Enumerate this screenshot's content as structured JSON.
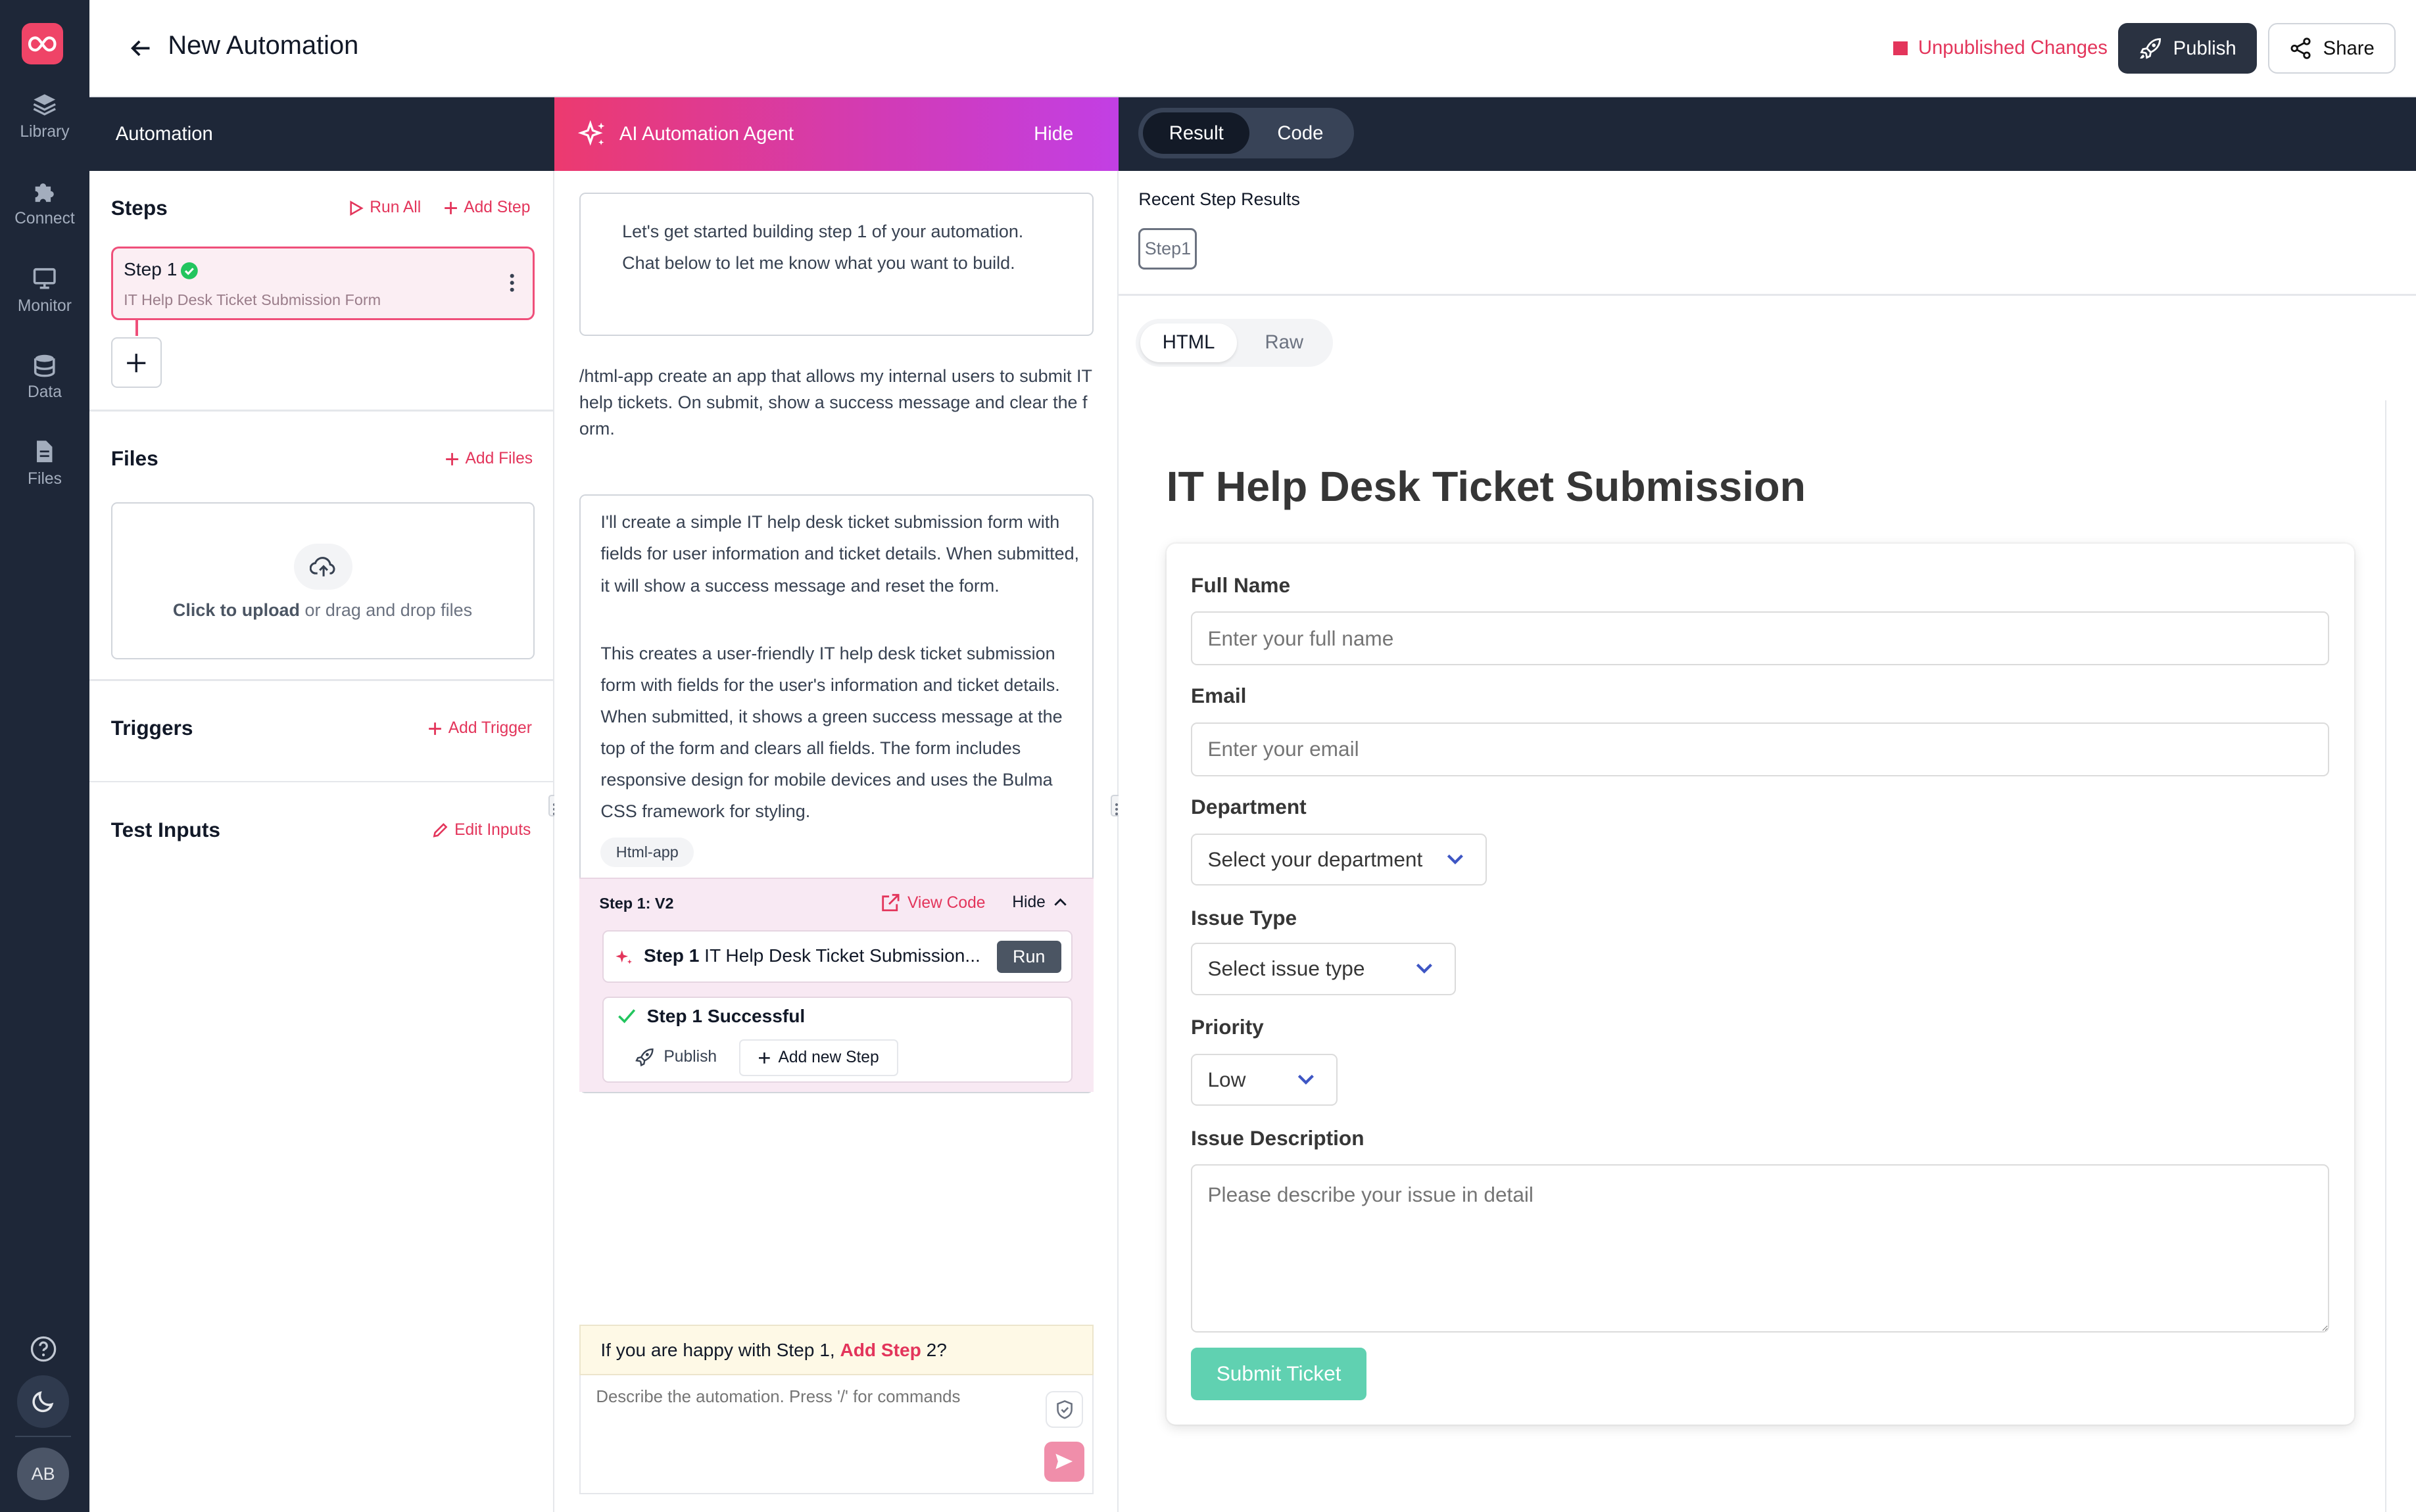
{
  "nav": {
    "items": [
      {
        "label": "Library",
        "icon": "layers-icon"
      },
      {
        "label": "Connect",
        "icon": "puzzle-icon"
      },
      {
        "label": "Monitor",
        "icon": "monitor-icon"
      },
      {
        "label": "Data",
        "icon": "database-icon"
      },
      {
        "label": "Files",
        "icon": "file-icon"
      }
    ],
    "avatar": "AB"
  },
  "header": {
    "title": "New Automation",
    "unpublished": "Unpublished Changes",
    "publish": "Publish",
    "share": "Share"
  },
  "bars": {
    "left": "Automation",
    "agent": "AI Automation Agent",
    "hide": "Hide",
    "result_tab": "Result",
    "code_tab": "Code"
  },
  "steps": {
    "heading": "Steps",
    "run_all": "Run All",
    "add_step": "Add Step",
    "step_title": "Step 1",
    "step_subtitle": "IT Help Desk Ticket Submission Form"
  },
  "files": {
    "heading": "Files",
    "add_files": "Add Files",
    "upload_bold": "Click to upload",
    "upload_rest": " or drag and drop files"
  },
  "triggers": {
    "heading": "Triggers",
    "add_trigger": "Add Trigger"
  },
  "test_inputs": {
    "heading": "Test Inputs",
    "edit_inputs": "Edit Inputs"
  },
  "chat": {
    "intro": "Let's get started building step 1 of your automation. Chat below to let me know what you want to build.",
    "user_msg": "/html-app create an app that allows my internal users to submit IT help tickets. On submit, show a success message and clear the form.",
    "reply_p1": "I'll create a simple IT help desk ticket submission form with fields for user information and ticket details. When submitted, it will show a success message and reset the form.",
    "reply_p2": "This creates a user-friendly IT help desk ticket submission form with fields for the user's information and ticket details. When submitted, it shows a green success message at the top of the form and clears all fields. The form includes responsive design for mobile devices and uses the Bulma CSS framework for styling.",
    "tag": "Html-app",
    "version": "Step 1: V2",
    "view_code": "View Code",
    "hide": "Hide",
    "step_bold": "Step 1",
    "step_text": " IT Help Desk Ticket Submission...",
    "run": "Run",
    "success": "Step 1 Successful",
    "publish": "Publish",
    "add_new_step": "Add new Step",
    "happy_pre": "If you are happy with Step 1, ",
    "happy_link": "Add Step",
    "happy_post": " 2?",
    "composer_placeholder": "Describe the automation. Press '/' for commands"
  },
  "results": {
    "heading": "Recent Step Results",
    "chip": "Step1",
    "html_tab": "HTML",
    "raw_tab": "Raw"
  },
  "form": {
    "title": "IT Help Desk Ticket Submission",
    "full_name_label": "Full Name",
    "full_name_placeholder": "Enter your full name",
    "email_label": "Email",
    "email_placeholder": "Enter your email",
    "department_label": "Department",
    "department_value": "Select your department",
    "issue_type_label": "Issue Type",
    "issue_type_value": "Select issue type",
    "priority_label": "Priority",
    "priority_value": "Low",
    "description_label": "Issue Description",
    "description_placeholder": "Please describe your issue in detail",
    "submit": "Submit Ticket"
  },
  "colors": {
    "accent": "#e3355b",
    "nav_bg": "#1e2738",
    "submit": "#60d1b1",
    "success": "#22c55e"
  }
}
